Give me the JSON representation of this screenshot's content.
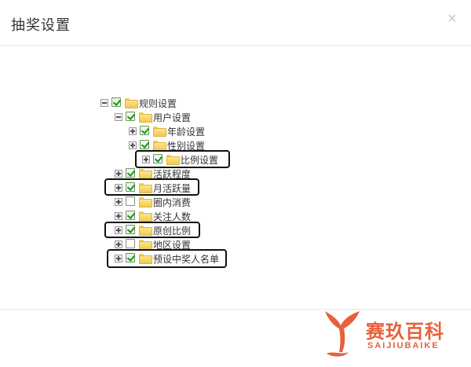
{
  "dialog": {
    "title": "抽奖设置",
    "close_glyph": "×"
  },
  "tree": {
    "nodes": [
      {
        "label": "规则设置",
        "checked": true,
        "expanded": true
      },
      {
        "label": "用户设置",
        "checked": true,
        "expanded": true
      },
      {
        "label": "年龄设置",
        "checked": true,
        "expanded": false
      },
      {
        "label": "性别设置",
        "checked": true,
        "expanded": false
      },
      {
        "label": "比例设置",
        "checked": true,
        "expanded": false
      },
      {
        "label": "活跃程度",
        "checked": true,
        "expanded": false
      },
      {
        "label": "月活跃量",
        "checked": true,
        "expanded": false
      },
      {
        "label": "圈内消费",
        "checked": false,
        "expanded": false
      },
      {
        "label": "关注人数",
        "checked": true,
        "expanded": false
      },
      {
        "label": "原创比例",
        "checked": true,
        "expanded": false
      },
      {
        "label": "地区设置",
        "checked": false,
        "expanded": false
      },
      {
        "label": "预设中奖人名单",
        "checked": true,
        "expanded": false
      }
    ]
  },
  "watermark": {
    "name": "赛玖百科",
    "sub": "SAIJIUBAIKE"
  },
  "colors": {
    "highlight_border": "#111111",
    "watermark": "#e8603c",
    "check": "#1f8f1f",
    "folder": "#f1c94e"
  }
}
